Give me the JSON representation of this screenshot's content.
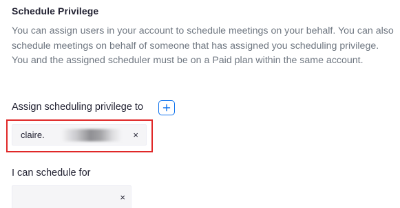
{
  "schedule_privilege": {
    "title": "Schedule Privilege",
    "description": "You can assign users in your account to schedule meetings on your behalf. You can also schedule meetings on behalf of someone that has assigned you scheduling privilege. You and the assigned scheduler must be on a Paid plan within the same account.",
    "assign": {
      "label": "Assign scheduling privilege to",
      "add_button_icon": "plus-icon",
      "assignees": [
        {
          "name": "claire.",
          "remove_label": "×"
        }
      ]
    },
    "can_schedule_for": {
      "label": "I can schedule for",
      "remove_label": "×"
    }
  },
  "colors": {
    "accent": "#0e72ed",
    "highlight": "#e02828",
    "text_primary": "#232333",
    "text_secondary": "#6e7680",
    "chip_background": "#f5f5f7"
  }
}
